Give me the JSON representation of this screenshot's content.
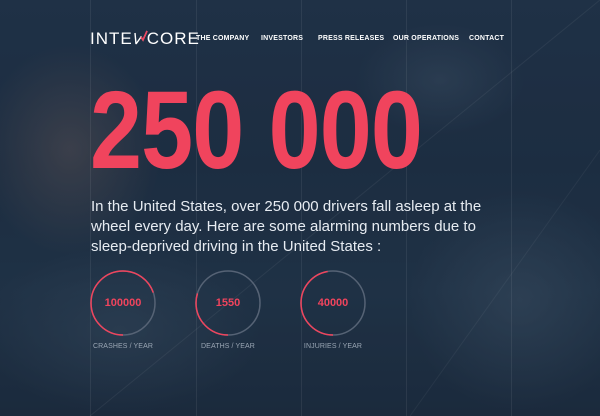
{
  "header": {
    "logo_text_a": "INTE",
    "logo_text_b": "CORE",
    "nav": [
      {
        "label": "THE COMPANY"
      },
      {
        "label": "INVESTORS"
      },
      {
        "label": "PRESS RELEASES"
      },
      {
        "label": "OUR OPERATIONS"
      },
      {
        "label": "CONTACT"
      }
    ]
  },
  "hero": {
    "headline_number": "250 000",
    "intro": "In the United States, over 250 000 drivers fall asleep at the wheel every day. Here are some alarming numbers due to sleep-deprived driving in the United States :"
  },
  "stats": [
    {
      "value": "100000",
      "label": "CRASHES / YEAR"
    },
    {
      "value": "1550",
      "label": "DEATHS / YEAR"
    },
    {
      "value": "40000",
      "label": "INJURIES / YEAR"
    }
  ],
  "colors": {
    "accent": "#f0445d",
    "background": "#1f3044",
    "text": "#ffffff"
  }
}
